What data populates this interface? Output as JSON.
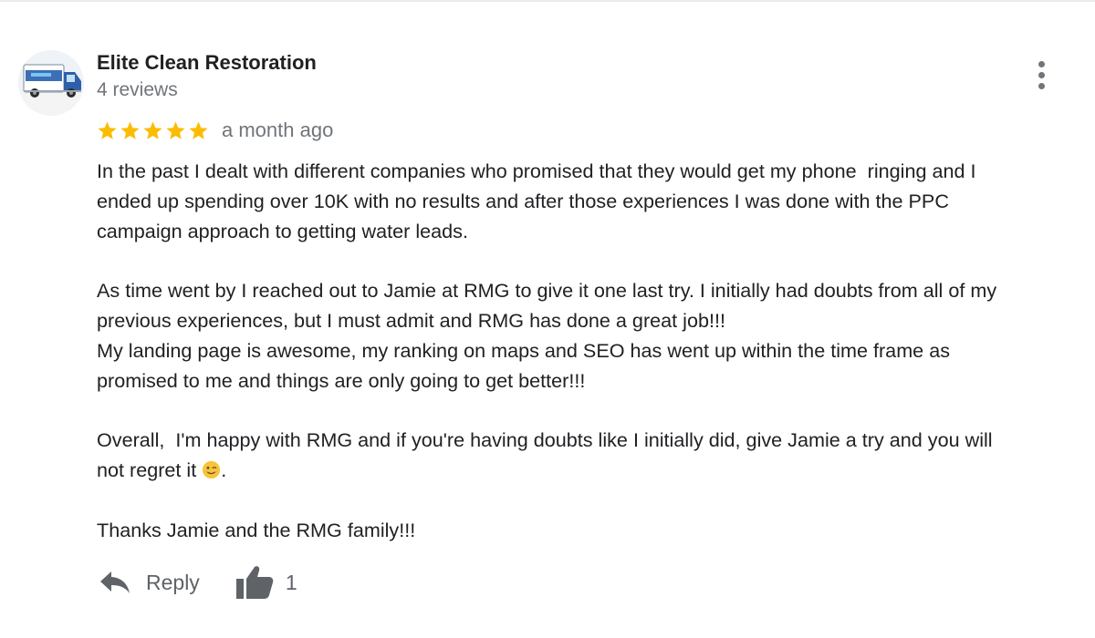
{
  "reviewer": {
    "name": "Elite Clean Restoration",
    "review_count": "4 reviews",
    "avatar_icon": "van-avatar"
  },
  "review": {
    "rating": 5,
    "rating_max": 5,
    "star_color": "#fbbc04",
    "date": "a month ago",
    "paragraphs": [
      {
        "lines": [
          "In the past I dealt with different companies who promised that they would get my phone  ringing and I",
          "ended up spending over 10K with no results and after those experiences I was done with the PPC",
          "campaign approach to getting water leads."
        ]
      },
      {
        "lines": [
          "As time went by I reached out to Jamie at RMG to give it one last try. I initially had doubts from all of my",
          "previous experiences, but I must admit and RMG has done a great job!!!",
          "My landing page is awesome, my ranking on maps and SEO has went up within the time frame as",
          "promised to me and things are only going to get better!!!"
        ]
      },
      {
        "lines": [
          "Overall,  I'm happy with RMG and if you're having doubts like I initially did, give Jamie a try and you will"
        ],
        "last_line_before_emoji": "not regret it ",
        "emoji": "winking-face-emoji",
        "last_line_after_emoji": "."
      },
      {
        "lines": [
          "Thanks Jamie and the RMG family!!!"
        ]
      }
    ]
  },
  "actions": {
    "reply_label": "Reply",
    "like_count": "1"
  },
  "colors": {
    "text": "#202124",
    "secondary": "#70757a",
    "action": "#5f6368"
  }
}
